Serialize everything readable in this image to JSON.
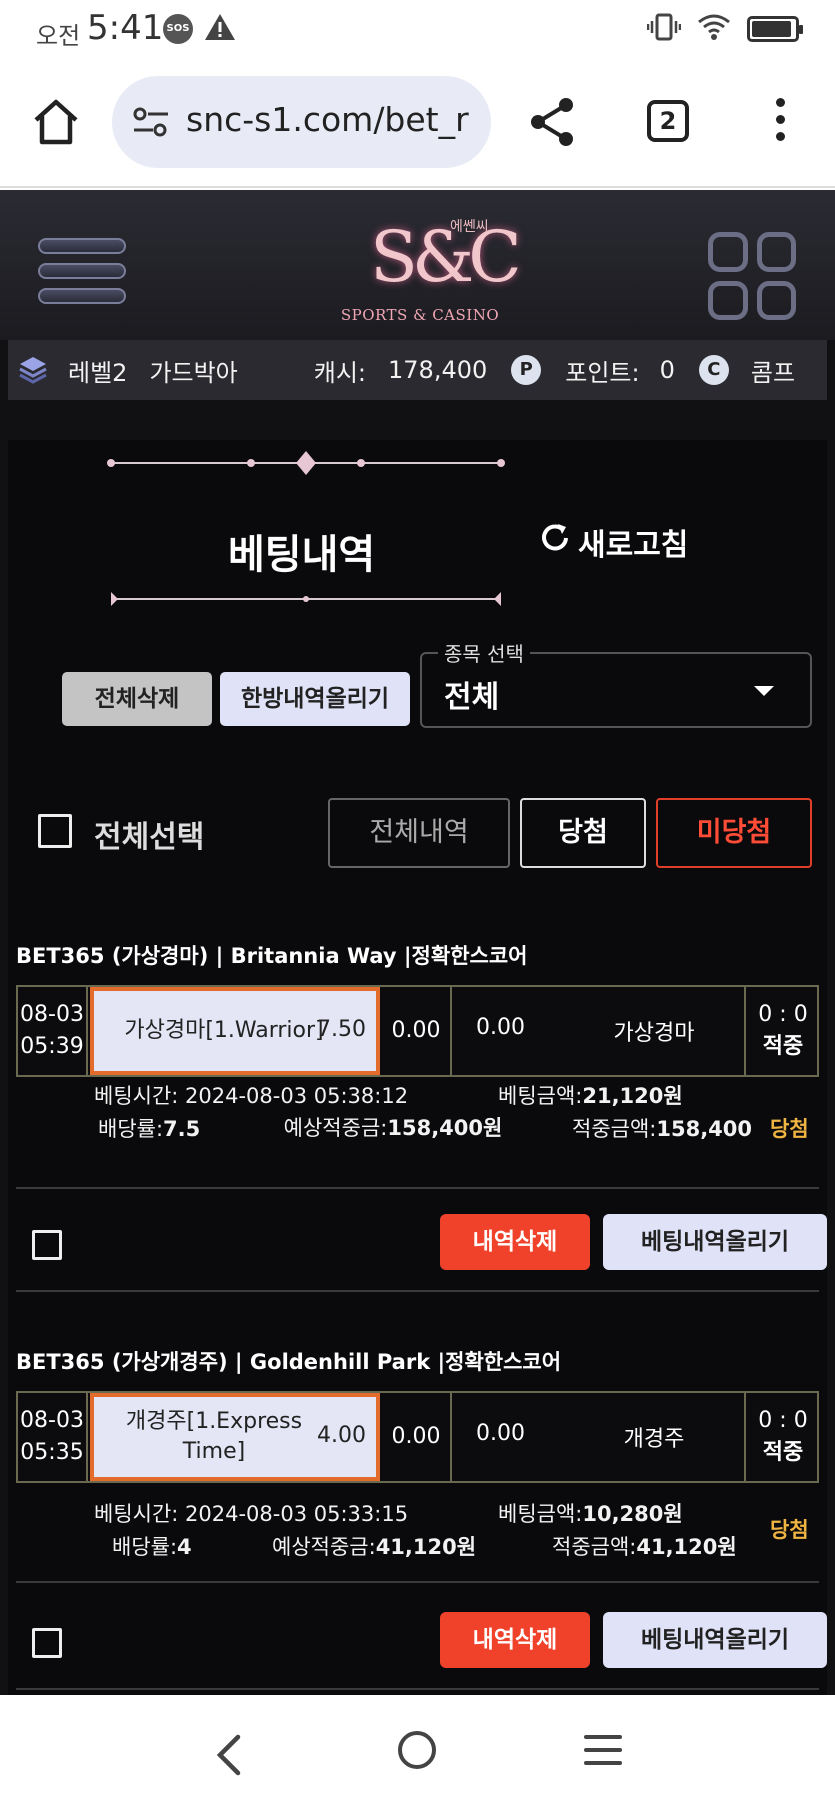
{
  "status_bar": {
    "ampm": "오전",
    "time": "5:41",
    "sos": "SOS"
  },
  "browser": {
    "url": "snc-s1.com/bet_r",
    "tab_count": "2"
  },
  "site": {
    "logo_mark": "S&C",
    "logo_korean": "에쎈씨",
    "logo_sub": "SPORTS & CASINO",
    "user": {
      "level": "레벨2",
      "nickname": "가드박아",
      "cash_label": "캐시:",
      "cash_value": "178,400",
      "point_icon": "P",
      "point_label": "포인트:",
      "point_value": "0",
      "comp_icon": "C",
      "comp_label": "콤프"
    },
    "page_title": "베팅내역",
    "refresh_label": "새로고침",
    "delete_all_label": "전체삭제",
    "upload_one_label": "한방내역올리기",
    "sport_select": {
      "label": "종목 선택",
      "value": "전체"
    },
    "select_all_label": "전체선택",
    "filters": {
      "all": "전체내역",
      "win": "당첨",
      "lose": "미당첨"
    },
    "bets": [
      {
        "title": "BET365 (가상경마) | Britannia Way  |정확한스코어",
        "date": "08-03",
        "time": "05:39",
        "pick": "가상경마[1.Warrior]",
        "pick_odds": "7.50",
        "draw": "0.00",
        "away_odds": "0.00",
        "away_name": "가상경마",
        "score": "0 : 0",
        "hit": "적중",
        "bet_time": "베팅시간: 2024-08-03 05:38:12",
        "bet_amount_label": "베팅금액:",
        "bet_amount": "21,120원",
        "odds_label": "배당률:",
        "odds": "7.5",
        "expected_label": "예상적중금:",
        "expected": "158,400원",
        "win_amount_label": "적중금액:",
        "win_amount": "158,400",
        "result": "당첨",
        "delete_label": "내역삭제",
        "upload_label": "베팅내역올리기"
      },
      {
        "title": "BET365 (가상개경주) | Goldenhill Park  |정확한스코어",
        "date": "08-03",
        "time": "05:35",
        "pick": "개경주[1.Express Time]",
        "pick_odds": "4.00",
        "draw": "0.00",
        "away_odds": "0.00",
        "away_name": "개경주",
        "score": "0 : 0",
        "hit": "적중",
        "bet_time": "베팅시간: 2024-08-03 05:33:15",
        "bet_amount_label": "베팅금액:",
        "bet_amount": "10,280원",
        "odds_label": "배당률:",
        "odds": "4",
        "expected_label": "예상적중금:",
        "expected": "41,120원",
        "win_amount_label": "적중금액:",
        "win_amount": "41,120원",
        "result": "당첨",
        "delete_label": "내역삭제",
        "upload_label": "베팅내역올리기"
      }
    ]
  },
  "colors": {
    "accent_orange": "#e36b2b",
    "delete_red": "#f0422b",
    "win_gold": "#f0b443",
    "lose_red": "#ff4c36",
    "button_lavender": "#e0e3f7"
  }
}
